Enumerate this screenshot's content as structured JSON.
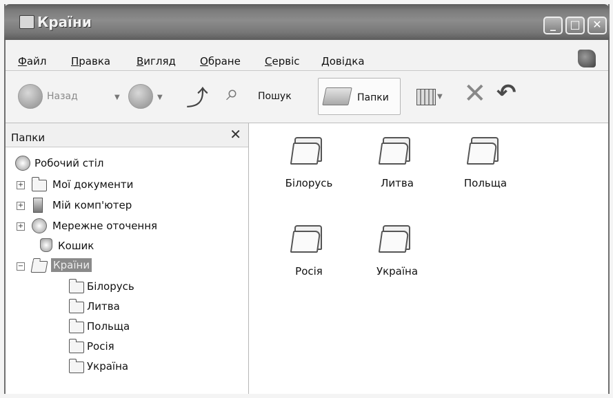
{
  "window": {
    "title": "Країни"
  },
  "menu": {
    "items": [
      "Файл",
      "Правка",
      "Вигляд",
      "Обране",
      "Сервіс",
      "Довідка"
    ]
  },
  "toolbar": {
    "back_label": "Назад",
    "search_label": "Пошук",
    "folders_label": "Папки"
  },
  "sidebar": {
    "title": "Папки",
    "close_glyph": "✕",
    "tree": [
      {
        "label": "Робочий стіл",
        "icon": "desktop-icon"
      },
      {
        "label": "Мої документи",
        "icon": "documents-folder-icon"
      },
      {
        "label": "Мій комп'ютер",
        "icon": "computer-icon"
      },
      {
        "label": "Мережне оточення",
        "icon": "network-icon"
      },
      {
        "label": "Кошик",
        "icon": "recycle-bin-icon"
      },
      {
        "label": "Країни",
        "icon": "open-folder-icon",
        "selected": true
      },
      {
        "label": "Білорусь",
        "icon": "folder-icon"
      },
      {
        "label": "Литва",
        "icon": "folder-icon"
      },
      {
        "label": "Польща",
        "icon": "folder-icon"
      },
      {
        "label": "Росія",
        "icon": "folder-icon"
      },
      {
        "label": "Україна",
        "icon": "folder-icon"
      }
    ]
  },
  "content": {
    "folders": [
      "Білорусь",
      "Литва",
      "Польща",
      "Росія",
      "Україна"
    ]
  }
}
